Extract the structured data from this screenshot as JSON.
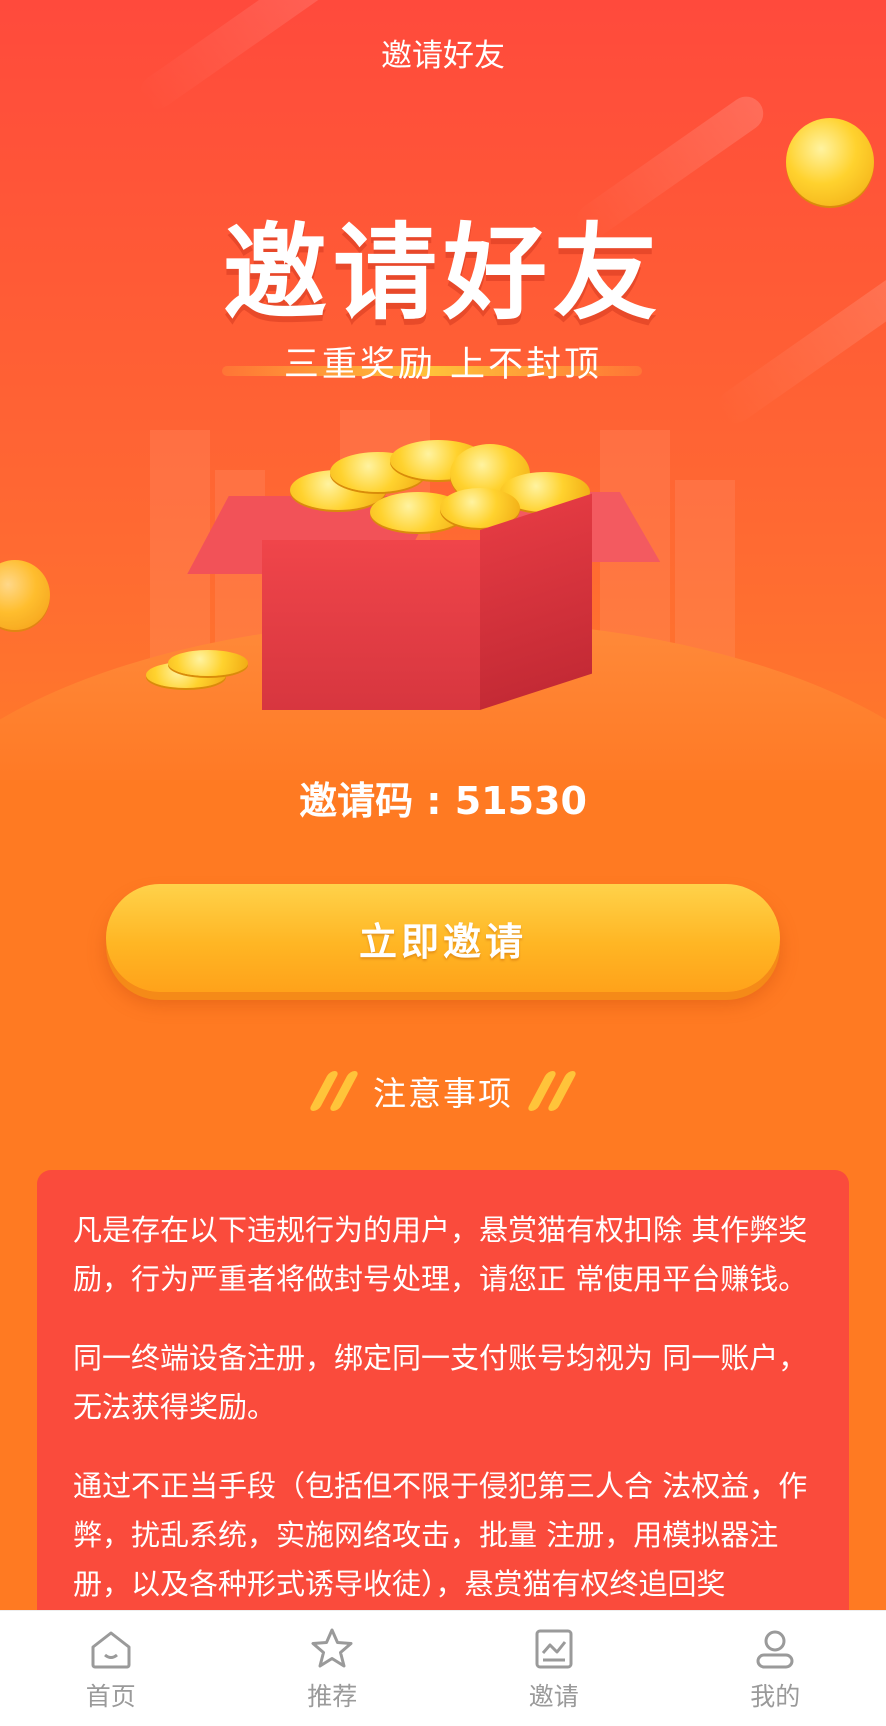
{
  "header": {
    "title": "邀请好友"
  },
  "hero": {
    "headline": "邀请好友",
    "subheadline": "三重奖励 上不封顶"
  },
  "invite": {
    "code_text": "邀请码 : 51530",
    "button_label": "立即邀请"
  },
  "notice": {
    "title": "注意事项",
    "paragraphs": [
      "凡是存在以下违规行为的用户，悬赏猫有权扣除 其作弊奖励，行为严重者将做封号处理，请您正 常使用平台赚钱。",
      "同一终端设备注册，绑定同一支付账号均视为 同一账户，无法获得奖励。",
      "通过不正当手段（包括但不限于侵犯第三人合 法权益，作弊，扰乱系统，实施网络攻击，批量 注册，用模拟器注册，以及各种形式诱导收徒），悬赏猫有权终追回奖"
    ]
  },
  "tabbar": {
    "items": [
      {
        "label": "首页",
        "icon": "home-icon"
      },
      {
        "label": "推荐",
        "icon": "star-icon"
      },
      {
        "label": "邀请",
        "icon": "invite-chart-icon"
      },
      {
        "label": "我的",
        "icon": "user-icon"
      }
    ]
  },
  "colors": {
    "hero_top": "#ff4a3c",
    "background": "#ff7a22",
    "button": "#ffb624",
    "card": "#fa4b3c",
    "tab_text": "#9a9a9a"
  }
}
